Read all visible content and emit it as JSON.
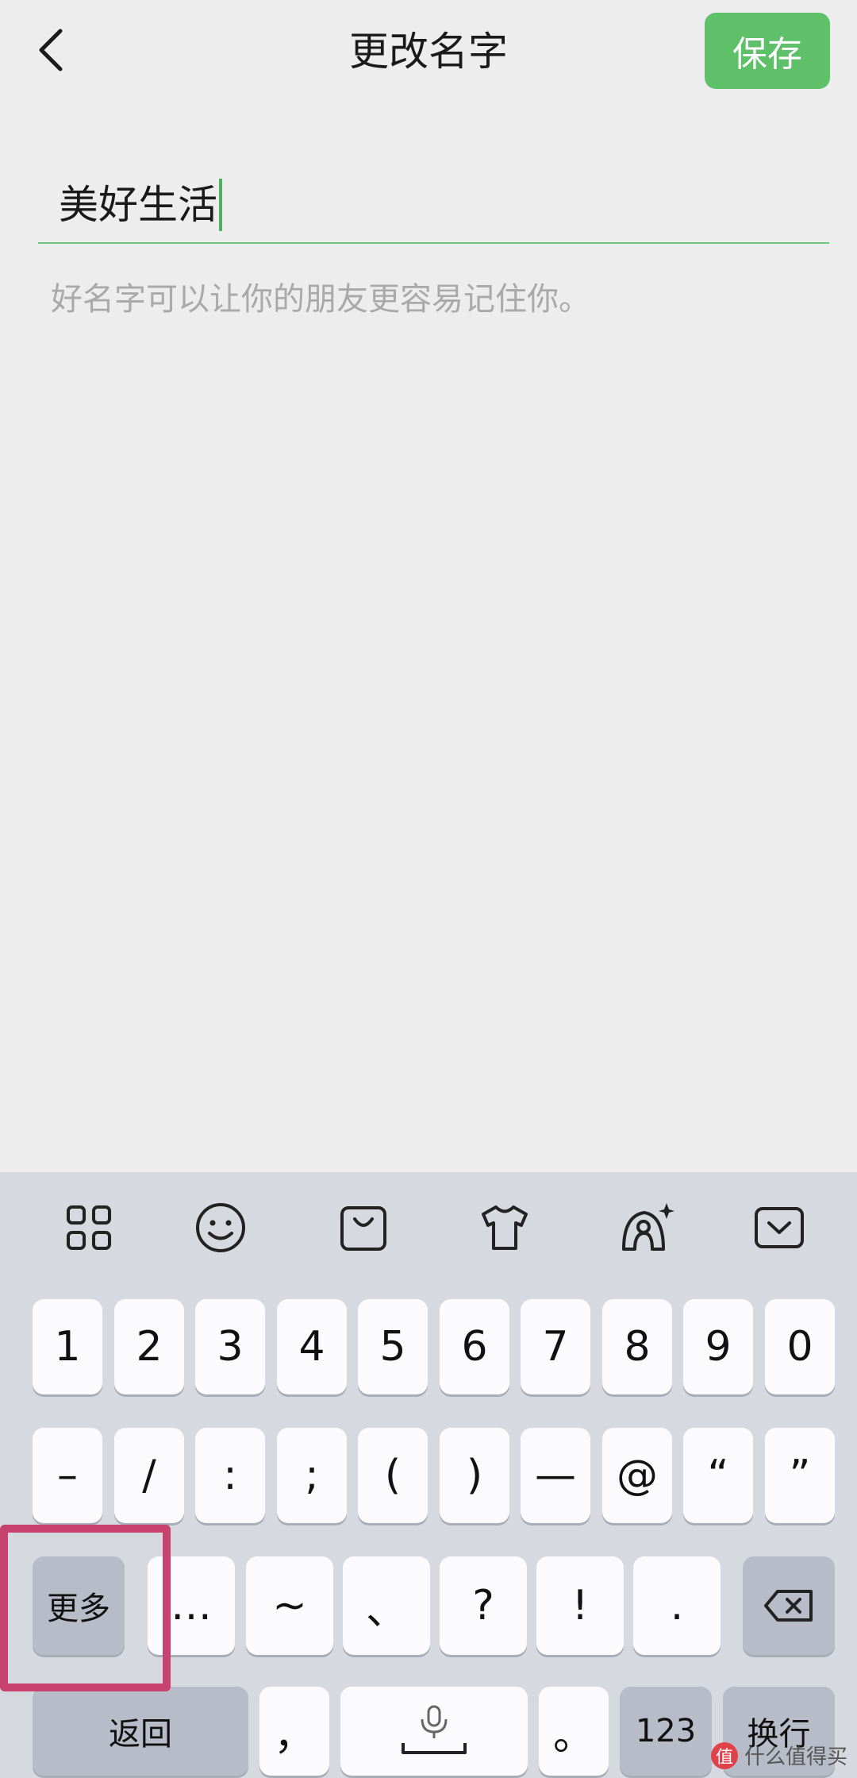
{
  "header": {
    "title": "更改名字",
    "save_label": "保存"
  },
  "name_field": {
    "value": "美好生活",
    "hint": "好名字可以让你的朋友更容易记住你。"
  },
  "keyboard": {
    "toolbar": [
      "grid-icon",
      "emoji-icon",
      "shopping-bag-icon",
      "tshirt-icon",
      "ai-assistant-icon",
      "collapse-keyboard-icon"
    ],
    "row1": [
      "1",
      "2",
      "3",
      "4",
      "5",
      "6",
      "7",
      "8",
      "9",
      "0"
    ],
    "row2": [
      "–",
      "/",
      ":",
      ";",
      "(",
      ")",
      "—",
      "@",
      "“",
      "”"
    ],
    "row3": {
      "more": "更多",
      "symbols": [
        "…",
        "~",
        "、",
        "?",
        "!",
        "."
      ]
    },
    "row4": {
      "back": "返回",
      "comma": "，",
      "period": "。",
      "num": "123",
      "enter": "换行"
    }
  },
  "watermark": {
    "text": "什么值得买",
    "badge": "值"
  }
}
